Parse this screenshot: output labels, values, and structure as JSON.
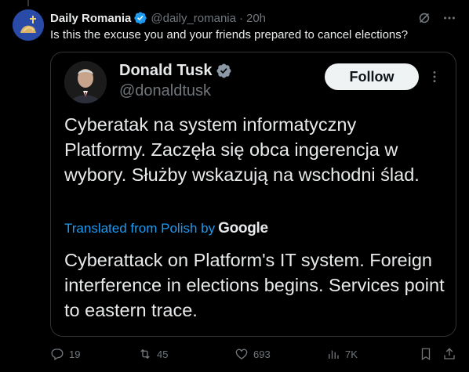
{
  "tweet": {
    "author_name": "Daily Romania",
    "author_handle": "@daily_romania",
    "separator": "·",
    "time": "20h",
    "text": "Is this the excuse you and your friends prepared to cancel elections?"
  },
  "quoted": {
    "author_name": "Donald Tusk",
    "author_handle": "@donaldtusk",
    "follow_label": "Follow",
    "original_text": "Cyberatak na system informatyczny Platformy. Zaczęła się obca ingerencja w wybory. Służby wskazują na wschodni ślad.",
    "translated_label": "Translated from Polish by",
    "translator_brand": "Google",
    "translated_text": "Cyberattack on Platform's IT system. Foreign interference in elections begins. Services point to eastern trace."
  },
  "actions": {
    "replies": "19",
    "reposts": "45",
    "likes": "693",
    "views": "7K"
  },
  "colors": {
    "background": "#000000",
    "text": "#e7e9ea",
    "muted": "#71767b",
    "accent": "#1d9bf0",
    "repost_green": "#00ba7c",
    "border": "#2f3336"
  },
  "icons": {
    "verified": "verified-badge-icon",
    "grok": "grok-icon",
    "more": "more-horizontal-icon",
    "reply": "reply-icon",
    "repost": "repost-icon",
    "like": "heart-icon",
    "views": "views-chart-icon",
    "bookmark": "bookmark-icon",
    "share": "share-icon"
  }
}
